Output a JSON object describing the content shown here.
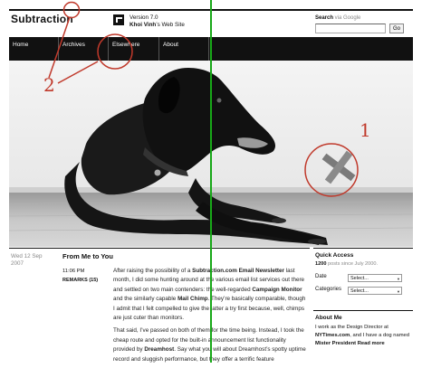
{
  "header": {
    "site_title": "Subtraction",
    "version": "Version 7.0",
    "owner_name": "Khoi Vinh",
    "owner_suffix": "’s Web Site",
    "search_label": "Search",
    "search_via": " via Google",
    "search_value": "",
    "search_button": "Go"
  },
  "nav": {
    "items": [
      "Home",
      "Archives",
      "Elsewhere",
      "About"
    ]
  },
  "hero": {
    "image_alt": "Black dog lying on a wooden floor"
  },
  "post": {
    "date": "Wed 12 Sep",
    "year": "2007",
    "title": "From Me to You",
    "time": "11:06 PM",
    "remarks": "REMARKS (15)",
    "p1_a": "After raising the possibility of a ",
    "p1_b": "Subtraction.com Email Newsletter",
    "p1_c": " last month, I did some hunting around at the various email list services out there and settled on two main contenders: the well-regarded ",
    "p1_d": "Campaign Monitor",
    "p1_e": " and the similarly capable ",
    "p1_f": "Mail Chimp",
    "p1_g": ". They’re basically comparable, though I admit that I felt compelled to give the latter a try first because, well, chimps are just cuter than monitors.",
    "p2_a": "That said, I’ve passed on both of them for the time being. Instead, I took the cheap route and opted for the built-in announcement list functionality provided by ",
    "p2_b": "Dreamhost",
    "p2_c": ". Say what you will about Dreamhost’s spotty uptime record and sluggish performance, but they offer a terrific feature"
  },
  "sidebar": {
    "quick_access_title": "Quick Access",
    "posts_count": "1200",
    "posts_suffix": " posts since July 2000.",
    "date_label": "Date",
    "date_select": "Select...",
    "categories_label": "Categories",
    "categories_select": "Select...",
    "about_title": "About Me",
    "about_a": "I work as the Design Director at ",
    "about_b": "NYTimes.com",
    "about_c": ", and I have a dog named ",
    "about_d": "Mister President",
    "about_e": " ",
    "about_f": "Read more"
  },
  "annotations": {
    "label_1": "1",
    "label_2": "2",
    "color": "#c0392b",
    "grid_line_color": "#18a818"
  }
}
